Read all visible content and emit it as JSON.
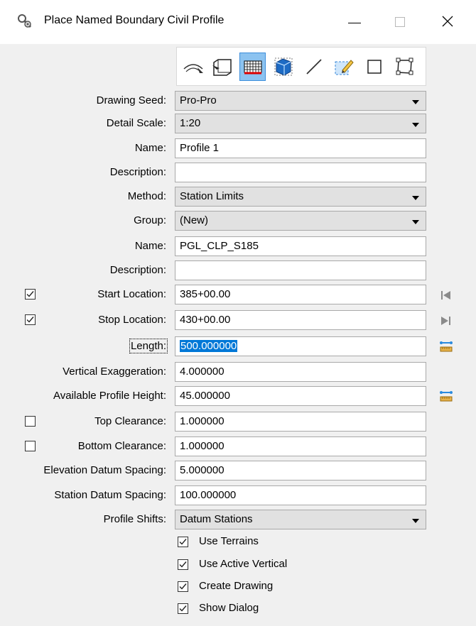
{
  "window": {
    "title": "Place Named Boundary Civil Profile",
    "icon": "tools-wrench-icon"
  },
  "toolbar": {
    "tools": [
      {
        "name": "civil-plan-icon",
        "active": false
      },
      {
        "name": "civil-cross-section-icon",
        "active": false
      },
      {
        "name": "civil-profile-icon",
        "active": true
      },
      {
        "name": "3d-cut-icon",
        "active": false
      },
      {
        "name": "two-points-icon",
        "active": false
      },
      {
        "name": "shape-icon",
        "active": false
      },
      {
        "name": "from-element-icon",
        "active": false
      },
      {
        "name": "from-view-icon",
        "active": false
      }
    ]
  },
  "form": {
    "drawing_seed": {
      "label": "Drawing Seed:",
      "value": "Pro-Pro"
    },
    "detail_scale": {
      "label": "Detail Scale:",
      "value": "1:20"
    },
    "name1": {
      "label": "Name:",
      "value": "Profile 1"
    },
    "description1": {
      "label": "Description:",
      "value": ""
    },
    "method": {
      "label": "Method:",
      "value": "Station Limits"
    },
    "group": {
      "label": "Group:",
      "value": "(New)"
    },
    "name2": {
      "label": "Name:",
      "value": "PGL_CLP_S185"
    },
    "description2": {
      "label": "Description:",
      "value": ""
    },
    "start_location": {
      "label": "Start Location:",
      "value": "385+00.00",
      "checked": true
    },
    "stop_location": {
      "label": "Stop Location:",
      "value": "430+00.00",
      "checked": true
    },
    "length": {
      "label": "Length:",
      "value": "500.000000"
    },
    "vertical_exaggeration": {
      "label": "Vertical Exaggeration:",
      "value": "4.000000"
    },
    "available_profile_height": {
      "label": "Available Profile Height:",
      "value": "45.000000"
    },
    "top_clearance": {
      "label": "Top Clearance:",
      "value": "1.000000",
      "checked": false
    },
    "bottom_clearance": {
      "label": "Bottom Clearance:",
      "value": "1.000000",
      "checked": false
    },
    "elevation_datum_spacing": {
      "label": "Elevation Datum Spacing:",
      "value": "5.000000"
    },
    "station_datum_spacing": {
      "label": "Station Datum Spacing:",
      "value": "100.000000"
    },
    "profile_shifts": {
      "label": "Profile Shifts:",
      "value": "Datum Stations"
    }
  },
  "options": [
    {
      "label": "Use Terrains",
      "checked": true
    },
    {
      "label": "Use Active Vertical",
      "checked": true
    },
    {
      "label": "Create Drawing",
      "checked": true
    },
    {
      "label": "Show Dialog",
      "checked": true
    }
  ],
  "colors": {
    "selection": "#0078d7",
    "active_tool": "#8cc3f0",
    "measure_icon": "#2a8adf"
  }
}
